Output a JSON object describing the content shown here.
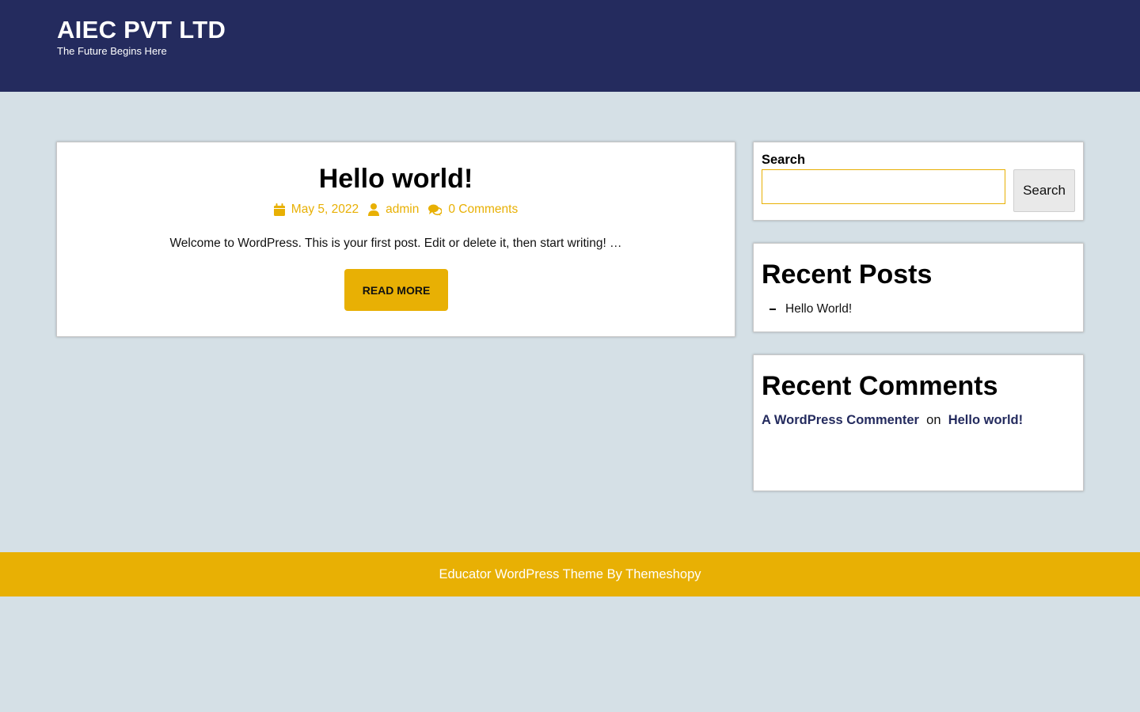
{
  "header": {
    "site_title": "AIEC PVT LTD",
    "tagline": "The Future Begins Here"
  },
  "post": {
    "title": "Hello world!",
    "date": "May 5, 2022",
    "author": "admin",
    "comments": "0 Comments",
    "excerpt": "Welcome to WordPress. This is your first post. Edit or delete it, then start writing! …",
    "read_more_label": "Read More"
  },
  "sidebar": {
    "search": {
      "label": "Search",
      "value": "",
      "button_label": "Search"
    },
    "recent_posts": {
      "title": "Recent Posts",
      "items": [
        {
          "label": "Hello World!"
        }
      ]
    },
    "recent_comments": {
      "title": "Recent Comments",
      "items": [
        {
          "author": "A WordPress Commenter",
          "connector": "on",
          "post": "Hello world!"
        }
      ]
    }
  },
  "footer": {
    "credit": "Educator WordPress Theme By Themeshopy"
  },
  "colors": {
    "header_bg": "#242b5e",
    "accent": "#e8b004",
    "page_bg": "#d5e0e6"
  },
  "icons": [
    "calendar-icon",
    "user-icon",
    "comments-icon"
  ]
}
